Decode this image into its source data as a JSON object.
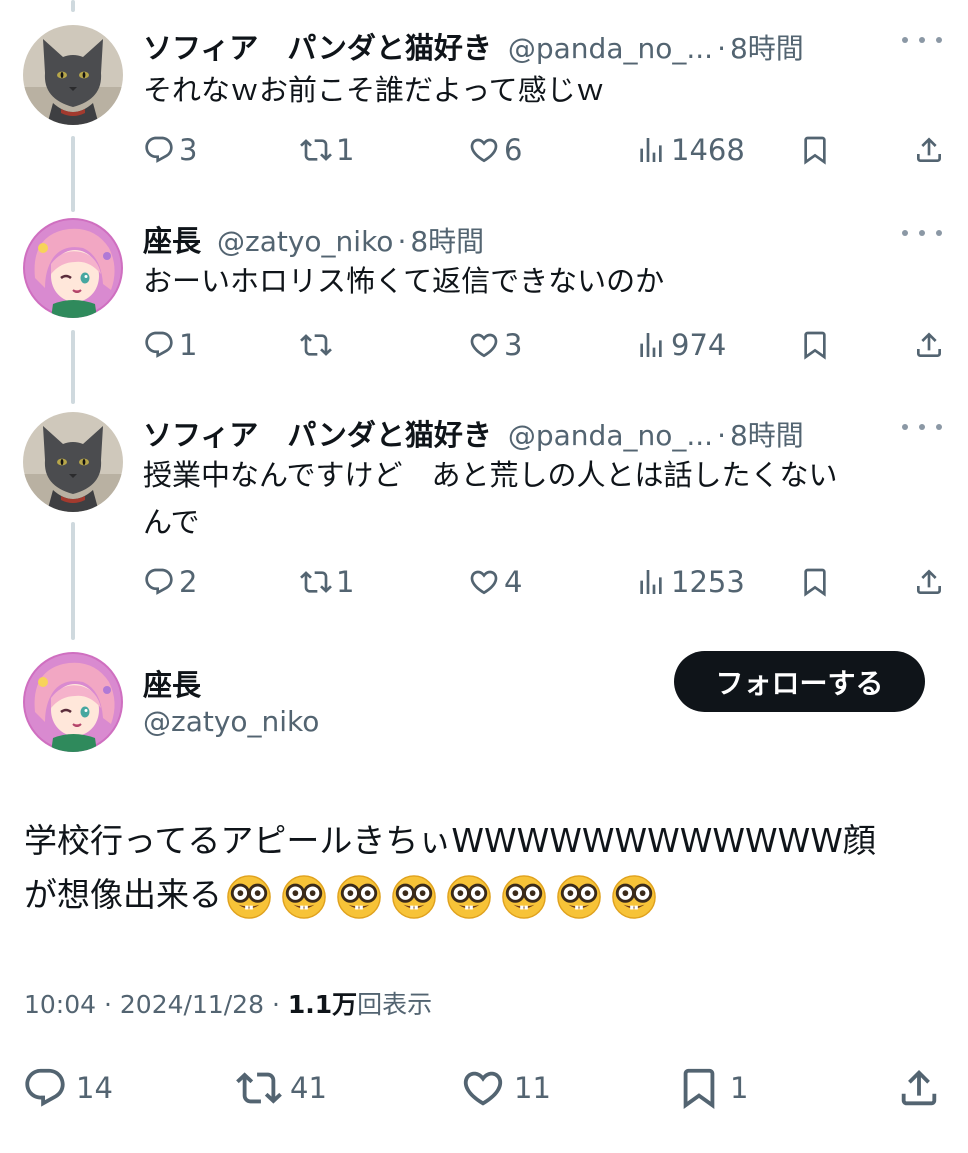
{
  "replies": [
    {
      "name": "ソフィア　パンダと猫好き",
      "handle": "@panda_no_...",
      "time": "8時間",
      "text": "それなｗお前こそ誰だよって感じｗ",
      "replies": "3",
      "retweets": "1",
      "likes": "6",
      "views": "1468",
      "avatar": "cat-avatar"
    },
    {
      "name": "座長",
      "handle": "@zatyo_niko",
      "time": "8時間",
      "text": "おーいホロリス怖くて返信できないのか",
      "replies": "1",
      "retweets": "",
      "likes": "3",
      "views": "974",
      "avatar": "anime-avatar"
    },
    {
      "name": "ソフィア　パンダと猫好き",
      "handle": "@panda_no_...",
      "time": "8時間",
      "text_line1": "授業中なんですけど　あと荒しの人とは話したくない",
      "text_line2": "んで",
      "replies": "2",
      "retweets": "1",
      "likes": "4",
      "views": "1253",
      "avatar": "cat-avatar"
    }
  ],
  "separator": "·",
  "main_post": {
    "name": "座長",
    "handle": "@zatyo_niko",
    "follow_label": "フォローする",
    "text_line1": "学校行ってるアピールきちぃWWWWWWWWWWWW顔",
    "text_line2": "が想像出来る",
    "emoji": "nerd-face",
    "emoji_count": 8,
    "time": "10:04",
    "date": "2024/11/28",
    "views_count": "1.1万",
    "views_label": "回表示",
    "replies": "14",
    "retweets": "41",
    "likes": "11",
    "bookmarks": "1"
  },
  "colors": {
    "text": "#0f1419",
    "secondary": "#536471",
    "thread_line": "#cfd9de",
    "follow_button": "#0f1419"
  }
}
